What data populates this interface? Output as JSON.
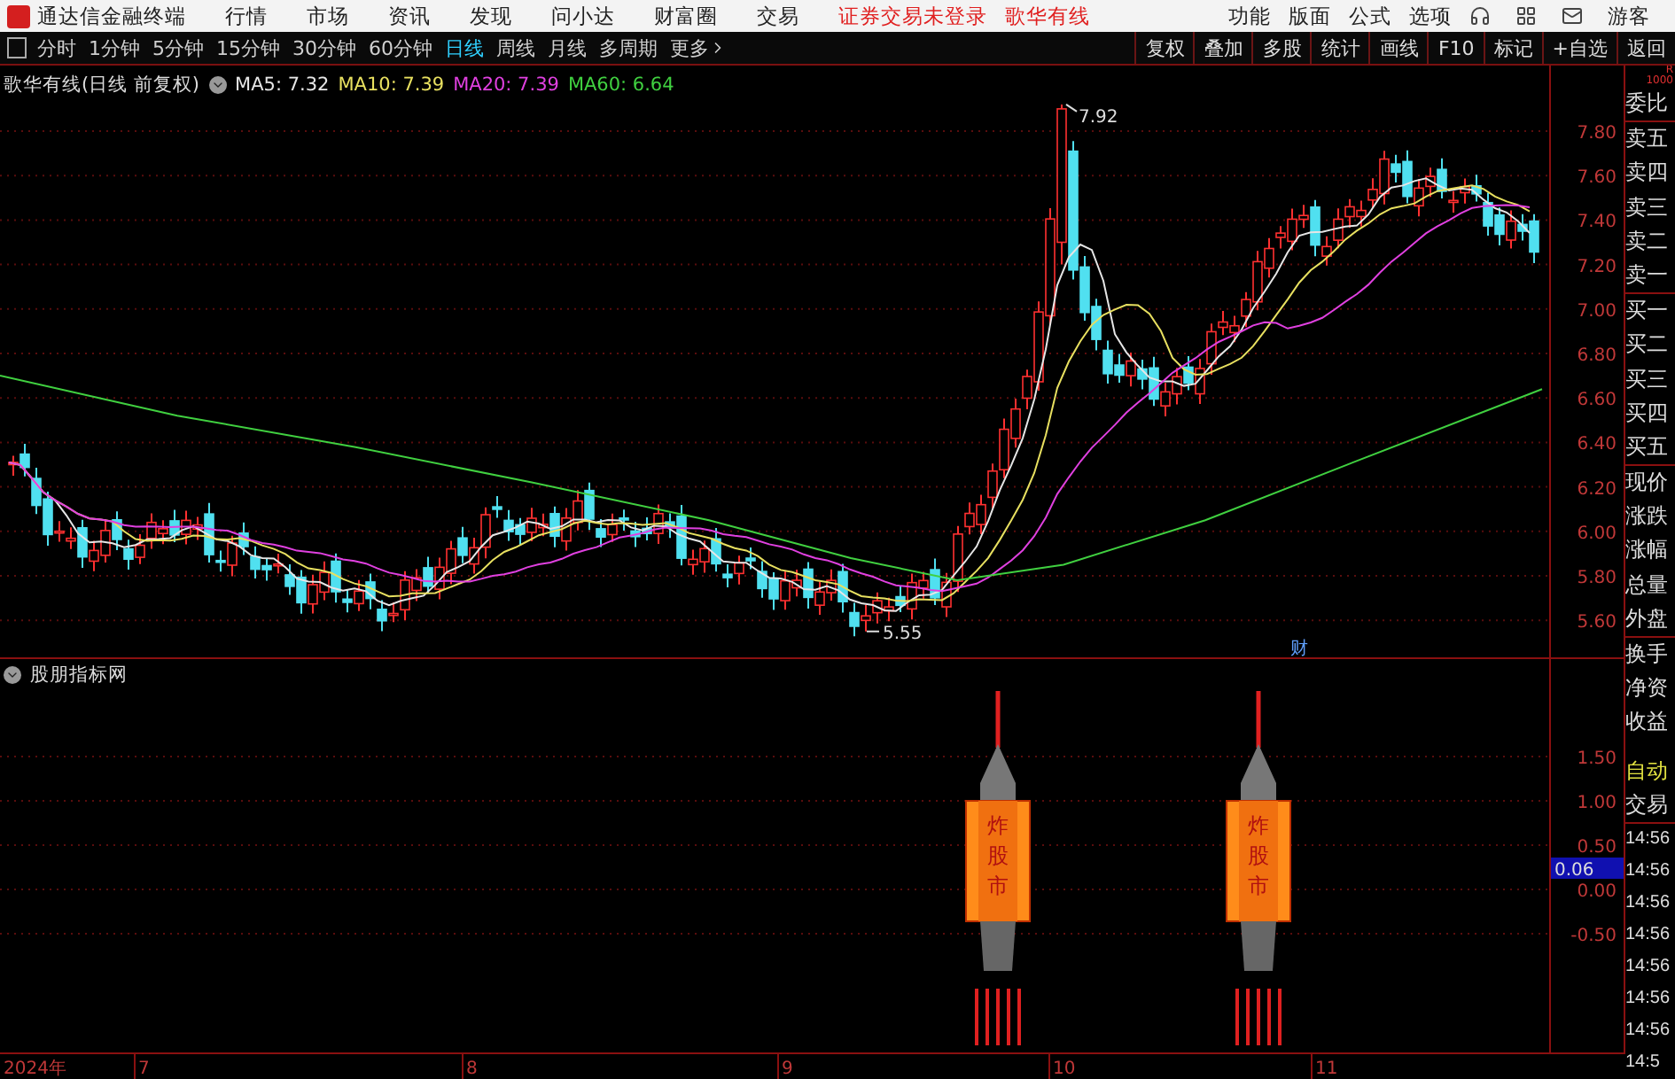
{
  "menubar": {
    "app_title": "通达信金融终端",
    "menus": [
      "行情",
      "市场",
      "资讯",
      "发现",
      "问小达",
      "财富圈",
      "交易"
    ],
    "notices": [
      "证券交易未登录",
      "歌华有线"
    ],
    "right_menus": [
      "功能",
      "版面",
      "公式",
      "选项"
    ],
    "user": "游客"
  },
  "toolbar": {
    "periods": [
      {
        "label": "分时",
        "selected": false
      },
      {
        "label": "1分钟",
        "selected": false
      },
      {
        "label": "5分钟",
        "selected": false
      },
      {
        "label": "15分钟",
        "selected": false
      },
      {
        "label": "30分钟",
        "selected": false
      },
      {
        "label": "60分钟",
        "selected": false
      },
      {
        "label": "日线",
        "selected": true
      },
      {
        "label": "周线",
        "selected": false
      },
      {
        "label": "月线",
        "selected": false
      },
      {
        "label": "多周期",
        "selected": false
      },
      {
        "label": "更多",
        "selected": false
      }
    ],
    "actions": [
      "复权",
      "叠加",
      "多股",
      "统计",
      "画线",
      "F10",
      "标记",
      "+自选",
      "返回"
    ]
  },
  "price_chart": {
    "title": "歌华有线(日线 前复权)",
    "ma": [
      {
        "label": "MA5: 7.32",
        "color": "#e6e6e6"
      },
      {
        "label": "MA10: 7.39",
        "color": "#e8e060"
      },
      {
        "label": "MA20: 7.39",
        "color": "#e040e0"
      },
      {
        "label": "MA60: 6.64",
        "color": "#40d040"
      }
    ],
    "yticks": [
      "7.80",
      "7.60",
      "7.40",
      "7.20",
      "7.00",
      "6.80",
      "6.60",
      "6.40",
      "6.20",
      "6.00",
      "5.80",
      "5.60"
    ],
    "high_label": "7.92",
    "low_label": "5.55",
    "event_marker": "财"
  },
  "indicator": {
    "title": "股朋指标网",
    "yticks": [
      "1.50",
      "1.00",
      "0.50",
      "0.00",
      "-0.50"
    ],
    "value": "0.06",
    "rockets": [
      {
        "label": "炸股市"
      },
      {
        "label": "炸股市"
      }
    ]
  },
  "date_axis": [
    "2024年",
    "7",
    "8",
    "9",
    "10",
    "11"
  ],
  "sidebar": {
    "header": [
      "R",
      "1000"
    ],
    "quote_labels": [
      "委比",
      "卖五",
      "卖四",
      "卖三",
      "卖二",
      "卖一",
      "买一",
      "买二",
      "买三",
      "买四",
      "买五",
      "现价",
      "涨跌",
      "涨幅",
      "总量",
      "外盘",
      "换手",
      "净资",
      "收益"
    ],
    "auto": "自动",
    "trade_header": "交易",
    "times": [
      "14:56",
      "14:56",
      "14:56",
      "14:56",
      "14:56",
      "14:56",
      "14:56",
      "14:5"
    ]
  }
}
